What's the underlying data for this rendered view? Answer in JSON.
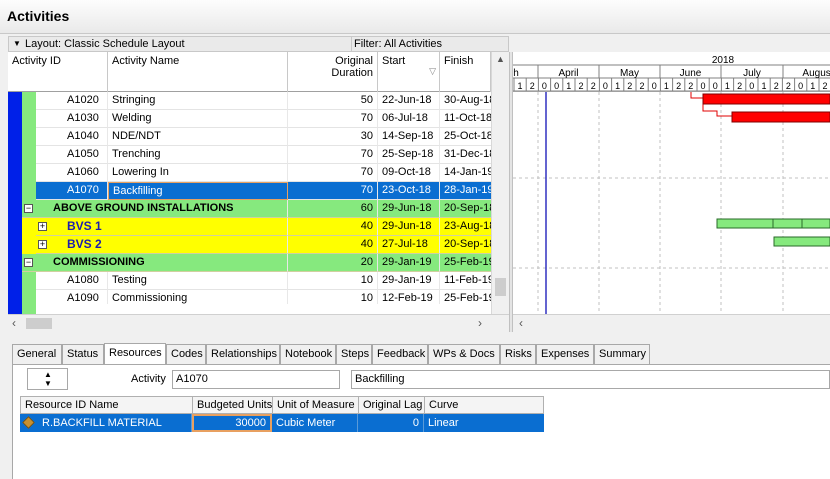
{
  "window": {
    "title": "Activities"
  },
  "layout_bar": {
    "layout_label": "Layout: Classic Schedule Layout",
    "filter_label": "Filter: All Activities"
  },
  "columns": {
    "activity_id": "Activity ID",
    "activity_name": "Activity Name",
    "original_duration": "Original Duration",
    "start": "Start",
    "finish": "Finish"
  },
  "rows": [
    {
      "id": "A1020",
      "name": "Stringing",
      "duration": "50",
      "start": "22-Jun-18",
      "finish": "30-Aug-18"
    },
    {
      "id": "A1030",
      "name": "Welding",
      "duration": "70",
      "start": "06-Jul-18",
      "finish": "11-Oct-18"
    },
    {
      "id": "A1040",
      "name": "NDE/NDT",
      "duration": "30",
      "start": "14-Sep-18",
      "finish": "25-Oct-18"
    },
    {
      "id": "A1050",
      "name": "Trenching",
      "duration": "70",
      "start": "25-Sep-18",
      "finish": "31-Dec-18"
    },
    {
      "id": "A1060",
      "name": "Lowering In",
      "duration": "70",
      "start": "09-Oct-18",
      "finish": "14-Jan-19"
    },
    {
      "id": "A1070",
      "name": "Backfilling",
      "duration": "70",
      "start": "23-Oct-18",
      "finish": "28-Jan-19"
    },
    {
      "wbs": "ABOVE GROUND INSTALLATIONS",
      "duration": "60",
      "start": "29-Jun-18",
      "finish": "20-Sep-18"
    },
    {
      "wbs": "BVS 1",
      "duration": "40",
      "start": "29-Jun-18",
      "finish": "23-Aug-18"
    },
    {
      "wbs": "BVS 2",
      "duration": "40",
      "start": "27-Jul-18",
      "finish": "20-Sep-18"
    },
    {
      "wbs": "COMMISSIONING",
      "duration": "20",
      "start": "29-Jan-19",
      "finish": "25-Feb-19"
    },
    {
      "id": "A1080",
      "name": "Testing",
      "duration": "10",
      "start": "29-Jan-19",
      "finish": "11-Feb-19"
    },
    {
      "id": "A1090",
      "name": "Commissioning",
      "duration": "10",
      "start": "12-Feb-19",
      "finish": "25-Feb-19"
    }
  ],
  "gantt": {
    "year": "2018",
    "months": [
      "h",
      "April",
      "May",
      "June",
      "July",
      "August"
    ],
    "weeks": [
      "1",
      "2",
      "0",
      "0",
      "1",
      "2",
      "2",
      "0",
      "1",
      "2",
      "2",
      "0",
      "1",
      "2",
      "2",
      "0",
      "0",
      "1",
      "2",
      "0",
      "1",
      "2",
      "2",
      "0",
      "1",
      "2"
    ],
    "colors": {
      "activity_bar": "#ff0000",
      "wbs_bar": "#86e97e",
      "data_date_line": "#3030c0"
    }
  },
  "tabs": [
    "General",
    "Status",
    "Resources",
    "Codes",
    "Relationships",
    "Notebook",
    "Steps",
    "Feedback",
    "WPs & Docs",
    "Risks",
    "Expenses",
    "Summary"
  ],
  "active_tab": "Resources",
  "detail": {
    "activity_label": "Activity",
    "activity_id": "A1070",
    "activity_name": "Backfilling",
    "resource_headers": [
      "Resource ID Name",
      "Budgeted Units",
      "Unit of Measure",
      "Original Lag",
      "Curve"
    ],
    "resource_row": {
      "resource": "R.BACKFILL MATERIAL",
      "budgeted_units": "30000",
      "unit_of_measure": "Cubic Meter",
      "original_lag": "0",
      "curve": "Linear"
    }
  },
  "accent": {
    "selection": "#0a6ed1",
    "wbs_green": "#86e97e",
    "wbs_yellow": "#ffff00",
    "band_blue": "#0020e8"
  }
}
